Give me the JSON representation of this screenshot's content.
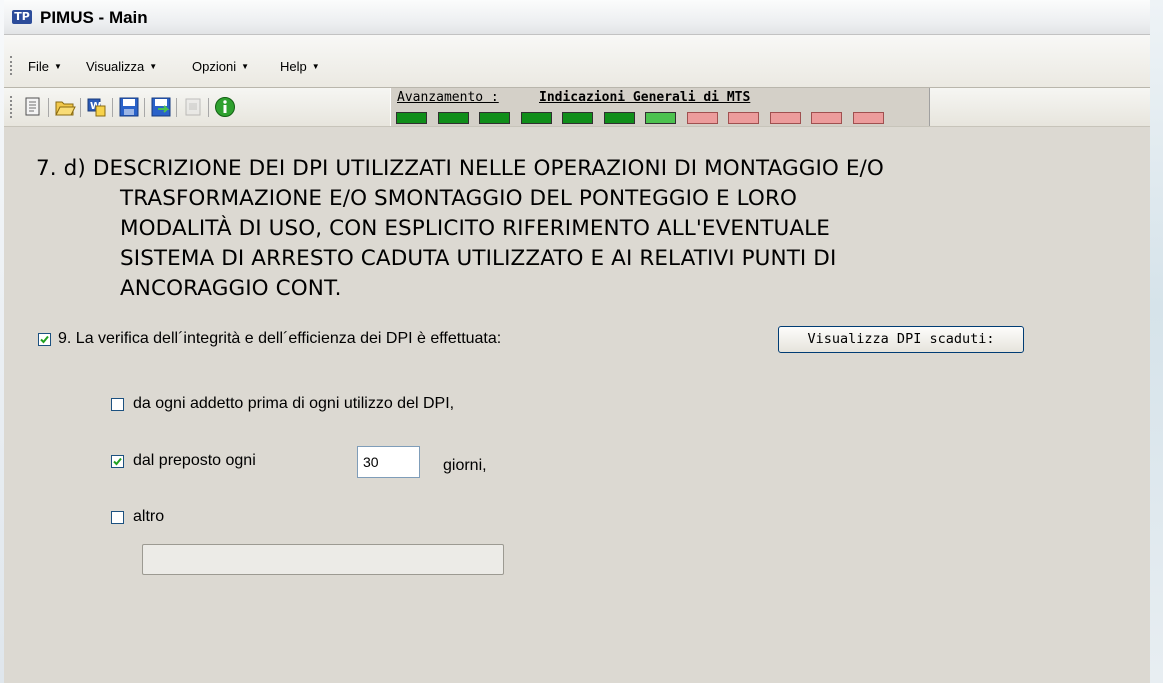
{
  "window": {
    "title": "PIMUS - Main",
    "logo_text": "TP"
  },
  "menu": [
    {
      "label": "File"
    },
    {
      "label": "Visualizza"
    },
    {
      "label": "Opzioni"
    },
    {
      "label": "Help"
    }
  ],
  "toolbar": {
    "buttons": [
      {
        "icon": "new-document-icon"
      },
      {
        "icon": "open-folder-icon"
      },
      {
        "icon": "word-export-icon"
      },
      {
        "icon": "save-icon"
      },
      {
        "icon": "save-as-icon"
      },
      {
        "icon": "print-icon",
        "disabled": true
      },
      {
        "icon": "info-icon"
      }
    ]
  },
  "progress": {
    "prefix": "Avanzamento :",
    "step": "Indicazioni Generali di MTS",
    "segments": [
      "done",
      "done",
      "done",
      "done",
      "done",
      "done",
      "current",
      "todo",
      "todo",
      "todo",
      "todo",
      "todo"
    ],
    "colors": {
      "done": "#108e1a",
      "current": "#4cc24f",
      "todo": "#ec9c9c"
    }
  },
  "section": {
    "title_lines": [
      "7. d) DESCRIZIONE DEI DPI UTILIZZATI NELLE OPERAZIONI DI MONTAGGIO E/O",
      "TRASFORMAZIONE E/O SMONTAGGIO DEL PONTEGGIO E LORO",
      "MODALITÀ DI USO, CON ESPLICITO RIFERIMENTO ALL'EVENTUALE",
      "SISTEMA DI ARRESTO CADUTA UTILIZZATO E AI RELATIVI PUNTI DI",
      "ANCORAGGIO CONT."
    ]
  },
  "form": {
    "main_check": {
      "label": "9. La verifica dell´integrità e dell´efficienza dei DPI è effettuata:",
      "checked": true
    },
    "button_label": "Visualizza DPI scaduti:",
    "options": [
      {
        "label": "da ogni addetto prima di ogni utilizzo del DPI,",
        "checked": false
      },
      {
        "label": "dal preposto ogni",
        "checked": true,
        "value": "30",
        "suffix": "giorni,"
      },
      {
        "label": "altro",
        "checked": false,
        "value": ""
      }
    ]
  }
}
